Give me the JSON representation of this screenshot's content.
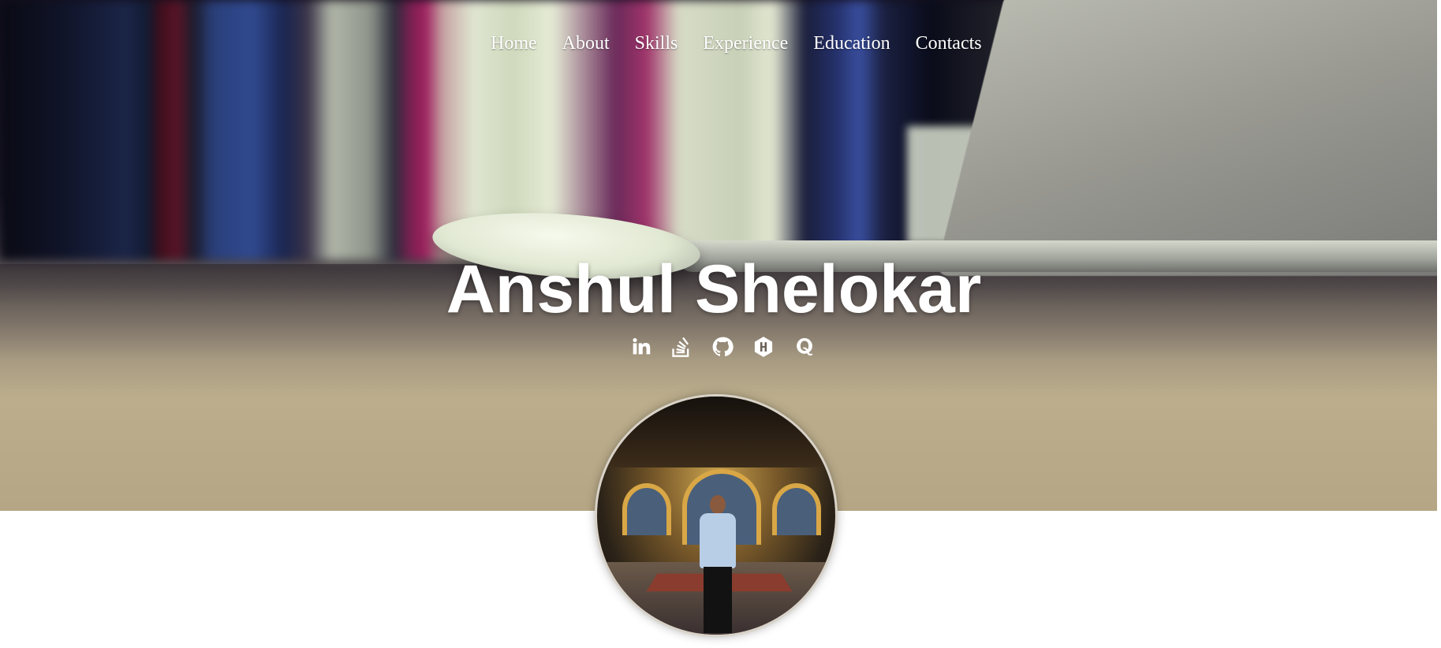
{
  "nav": {
    "items": [
      {
        "label": "Home"
      },
      {
        "label": "About"
      },
      {
        "label": "Skills"
      },
      {
        "label": "Experience"
      },
      {
        "label": "Education"
      },
      {
        "label": "Contacts"
      }
    ]
  },
  "hero": {
    "name": "Anshul Shelokar",
    "socials": [
      {
        "icon": "linkedin-icon"
      },
      {
        "icon": "stackoverflow-icon"
      },
      {
        "icon": "github-icon"
      },
      {
        "icon": "hashnode-icon"
      },
      {
        "icon": "quora-icon"
      }
    ]
  },
  "profile": {
    "avatar": "profile-photo"
  }
}
